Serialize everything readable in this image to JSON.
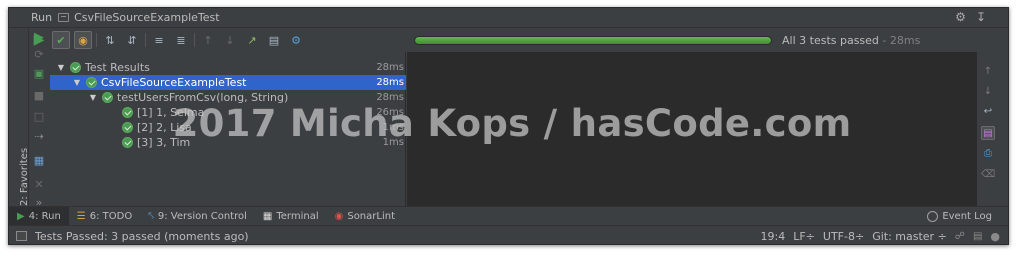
{
  "window": {
    "title_label": "Run",
    "config_name": "CsvFileSourceExampleTest"
  },
  "toolbar": {
    "buttons": [
      "rerun-icon",
      "show-passed-icon",
      "show-ignored-icon",
      "sort-alpha-icon",
      "sort-duration-icon",
      "expand-all-icon",
      "collapse-all-icon",
      "prev-failed-icon",
      "next-failed-icon",
      "export-icon",
      "import-icon",
      "settings-icon"
    ]
  },
  "progress": {
    "fraction": 1.0,
    "text": "All 3 tests passed",
    "separator": " - ",
    "duration": "28ms",
    "color": "#499c54"
  },
  "tree": {
    "rows": [
      {
        "name": "Test Results",
        "time": "28ms",
        "level": 0,
        "expanded": true,
        "selected": false
      },
      {
        "name": "CsvFileSourceExampleTest",
        "time": "28ms",
        "level": 1,
        "expanded": true,
        "selected": true
      },
      {
        "name": "testUsersFromCsv(long, String)",
        "time": "28ms",
        "level": 2,
        "expanded": true,
        "selected": false
      },
      {
        "name": "[1] 1, Selma",
        "time": "26ms",
        "level": 3,
        "expanded": false,
        "selected": false
      },
      {
        "name": "[2] 2, Lisa",
        "time": "1ms",
        "level": 3,
        "expanded": false,
        "selected": false
      },
      {
        "name": "[3] 3, Tim",
        "time": "1ms",
        "level": 3,
        "expanded": false,
        "selected": false
      }
    ]
  },
  "favorites": {
    "label": "2: Favorites"
  },
  "tabs": [
    {
      "label": "4: Run",
      "icon": "run-icon",
      "active": true
    },
    {
      "label": "6: TODO",
      "icon": "todo-icon",
      "active": false
    },
    {
      "label": "9: Version Control",
      "icon": "vcs-icon",
      "active": false
    },
    {
      "label": "Terminal",
      "icon": "terminal-icon",
      "active": false
    },
    {
      "label": "SonarLint",
      "icon": "sonarlint-icon",
      "active": false
    }
  ],
  "event_log": {
    "label": "Event Log"
  },
  "status": {
    "message": "Tests Passed: 3 passed (moments ago)",
    "position": "19:4",
    "line_sep": "LF÷",
    "encoding": "UTF-8÷",
    "git": "Git: master ÷"
  },
  "watermark": "2017 Micha Kops / hasCode.com"
}
